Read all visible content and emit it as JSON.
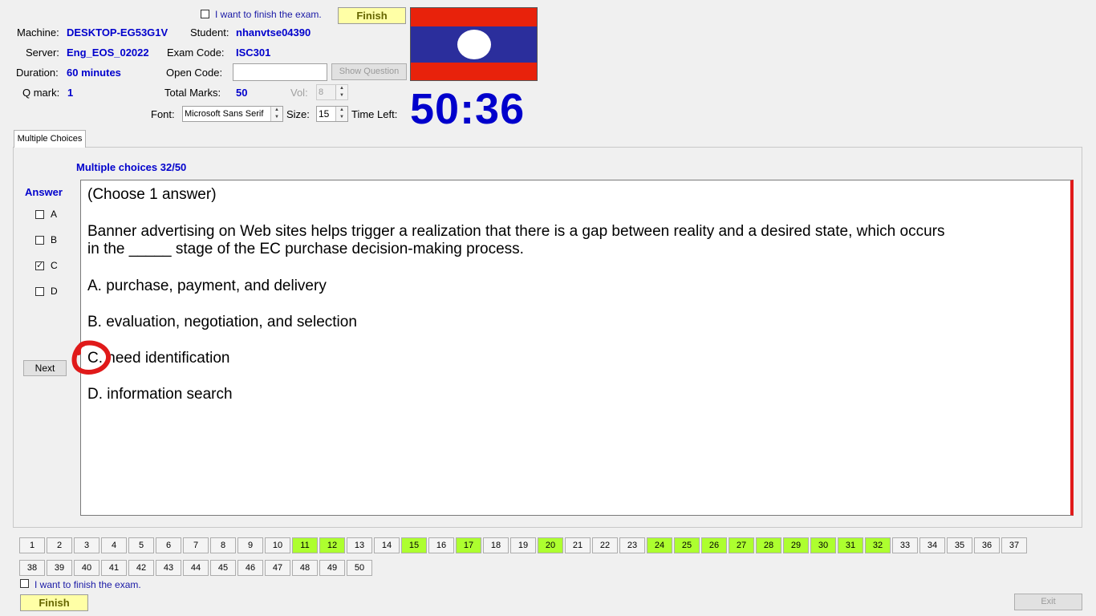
{
  "header": {
    "finish_check_label": "I want to finish the exam.",
    "finish_check_checked": false,
    "finish_button": "Finish",
    "machine_label": "Machine:",
    "machine": "DESKTOP-EG53G1V",
    "student_label": "Student:",
    "student": "nhanvtse04390",
    "server_label": "Server:",
    "server": "Eng_EOS_02022",
    "exam_code_label": "Exam Code:",
    "exam_code": "ISC301",
    "duration_label": "Duration:",
    "duration": "60 minutes",
    "open_code_label": "Open Code:",
    "open_code_value": "",
    "show_question_button": "Show Question",
    "qmark_label": "Q mark:",
    "qmark": "1",
    "total_marks_label": "Total Marks:",
    "total_marks": "50",
    "vol_label": "Vol:",
    "vol": "8",
    "font_label": "Font:",
    "font_value": "Microsoft Sans Serif",
    "size_label": "Size:",
    "size_value": "15",
    "time_left_label": "Time Left:",
    "time_left": "50:36",
    "flag_colors": {
      "red": "#e8220b",
      "blue": "#2b2e9c",
      "white": "#ffffff"
    }
  },
  "tabs": [
    {
      "label": "Multiple Choices",
      "active": true
    }
  ],
  "question_panel": {
    "heading": "Multiple choices 32/50",
    "answer_label": "Answer",
    "options": [
      {
        "label": "A",
        "checked": false
      },
      {
        "label": "B",
        "checked": false
      },
      {
        "label": "C",
        "checked": true
      },
      {
        "label": "D",
        "checked": false
      }
    ],
    "next_button": "Next",
    "question": {
      "instruction": "(Choose 1 answer)",
      "stem_line1": "Banner advertising on Web sites helps trigger a realization that there is a gap between reality and a desired state, which occurs",
      "stem_line2": "in the _____ stage of the EC purchase decision-making process.",
      "choices": [
        "A.  purchase, payment, and delivery",
        "B.  evaluation, negotiation, and selection",
        "C.  need identification",
        "D.  information search"
      ]
    }
  },
  "question_nav": {
    "done_color": "#adff2f",
    "row1": [
      {
        "n": "1",
        "done": false
      },
      {
        "n": "2",
        "done": false
      },
      {
        "n": "3",
        "done": false
      },
      {
        "n": "4",
        "done": false
      },
      {
        "n": "5",
        "done": false
      },
      {
        "n": "6",
        "done": false
      },
      {
        "n": "7",
        "done": false
      },
      {
        "n": "8",
        "done": false
      },
      {
        "n": "9",
        "done": false
      },
      {
        "n": "10",
        "done": false
      },
      {
        "n": "11",
        "done": true
      },
      {
        "n": "12",
        "done": true
      },
      {
        "n": "13",
        "done": false
      },
      {
        "n": "14",
        "done": false
      },
      {
        "n": "15",
        "done": true
      },
      {
        "n": "16",
        "done": false
      },
      {
        "n": "17",
        "done": true
      },
      {
        "n": "18",
        "done": false
      },
      {
        "n": "19",
        "done": false
      },
      {
        "n": "20",
        "done": true
      },
      {
        "n": "21",
        "done": false
      },
      {
        "n": "22",
        "done": false
      },
      {
        "n": "23",
        "done": false
      },
      {
        "n": "24",
        "done": true
      },
      {
        "n": "25",
        "done": true
      },
      {
        "n": "26",
        "done": true
      },
      {
        "n": "27",
        "done": true
      },
      {
        "n": "28",
        "done": true
      },
      {
        "n": "29",
        "done": true
      },
      {
        "n": "30",
        "done": true
      },
      {
        "n": "31",
        "done": true
      },
      {
        "n": "32",
        "done": true
      },
      {
        "n": "33",
        "done": false
      },
      {
        "n": "34",
        "done": false
      },
      {
        "n": "35",
        "done": false
      },
      {
        "n": "36",
        "done": false
      },
      {
        "n": "37",
        "done": false
      }
    ],
    "row2": [
      {
        "n": "38",
        "done": false
      },
      {
        "n": "39",
        "done": false
      },
      {
        "n": "40",
        "done": false
      },
      {
        "n": "41",
        "done": false
      },
      {
        "n": "42",
        "done": false
      },
      {
        "n": "43",
        "done": false
      },
      {
        "n": "44",
        "done": false
      },
      {
        "n": "45",
        "done": false
      },
      {
        "n": "46",
        "done": false
      },
      {
        "n": "47",
        "done": false
      },
      {
        "n": "48",
        "done": false
      },
      {
        "n": "49",
        "done": false
      },
      {
        "n": "50",
        "done": false
      }
    ]
  },
  "footer": {
    "finish_check_label": "I want to finish the exam.",
    "finish_check_checked": false,
    "finish_button": "Finish",
    "exit_button": "Exit"
  }
}
